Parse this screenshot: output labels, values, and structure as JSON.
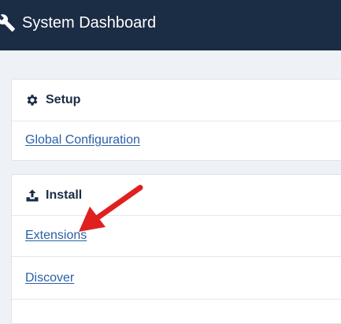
{
  "header": {
    "title": "System Dashboard",
    "icon": "wrench-icon"
  },
  "setup": {
    "title": "Setup",
    "icon": "gear-icon",
    "links": [
      {
        "label": "Global Configuration"
      }
    ]
  },
  "install": {
    "title": "Install",
    "icon": "upload-icon",
    "links": [
      {
        "label": "Extensions"
      },
      {
        "label": "Discover"
      }
    ]
  },
  "colors": {
    "topbar": "#1b2c45",
    "link": "#2a5fa9",
    "annotation_arrow": "#e02020"
  }
}
